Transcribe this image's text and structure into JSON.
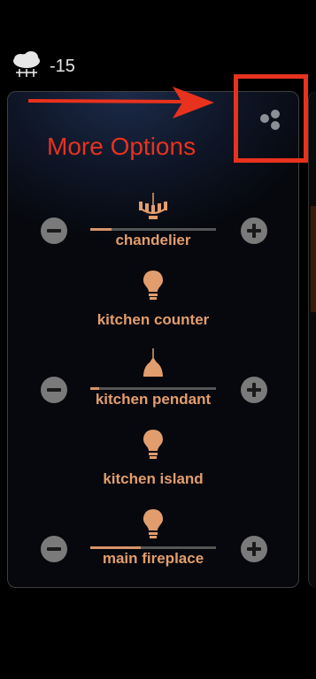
{
  "weather": {
    "icon": "snow-cloud-icon",
    "temperature": "-15"
  },
  "annotation": {
    "label": "More Options",
    "color": "#e8321e"
  },
  "accent_color": "#e29d6c",
  "devices": [
    {
      "label": "chandelier",
      "icon": "chandelier-icon",
      "dimmable": true,
      "level": 0.17
    },
    {
      "label": "kitchen counter",
      "icon": "bulb-icon",
      "dimmable": false
    },
    {
      "label": "kitchen pendant",
      "icon": "pendant-light-icon",
      "dimmable": true,
      "level": 0.07
    },
    {
      "label": "kitchen island",
      "icon": "bulb-icon",
      "dimmable": false
    },
    {
      "label": "main fireplace",
      "icon": "bulb-icon",
      "dimmable": true,
      "level": 0.4
    }
  ]
}
